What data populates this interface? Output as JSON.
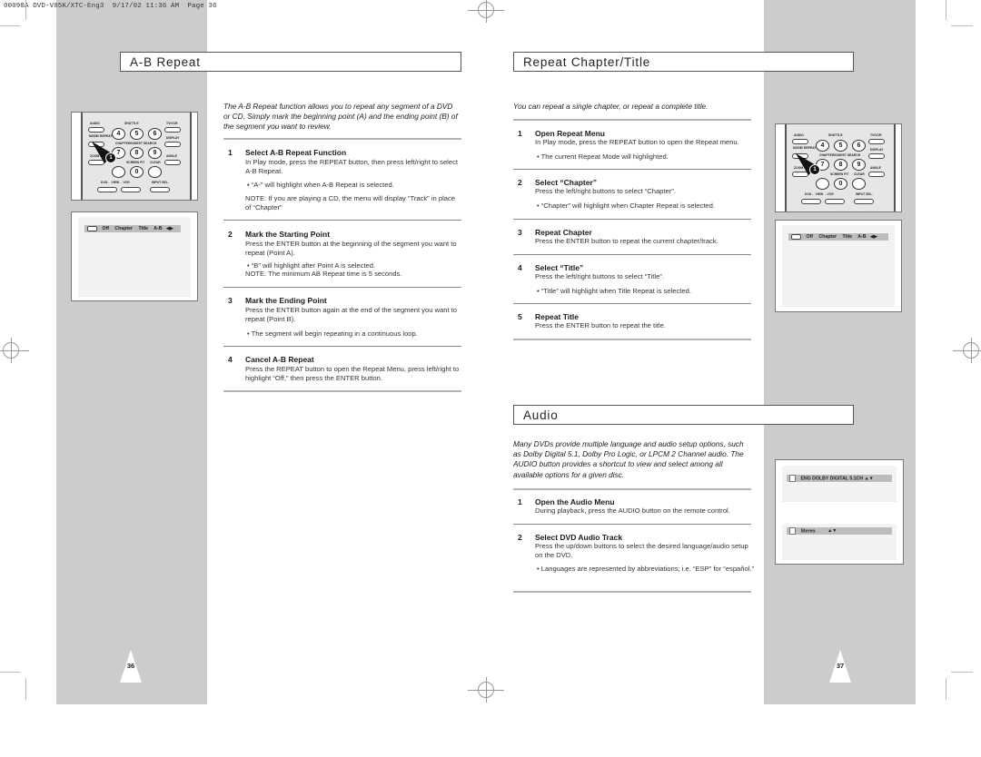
{
  "slug": "00090A DVD-V85K/XTC-Eng3  9/17/02 11:36 AM  Page 36",
  "left_page": {
    "page_number": "36",
    "section_title": "A-B Repeat",
    "intro": "The A-B Repeat function allows you to repeat any segment of a DVD or CD. Simply mark the beginning point (A) and the ending point (B) of the segment you want to review.",
    "steps": [
      {
        "num": "1",
        "title": "Select A-B Repeat Function",
        "text": "In Play mode, press the REPEAT button, then press left/right to select A-B Repeat.",
        "bullet": "“A-” will highlight when A-B Repeat is selected.",
        "note": "NOTE: If you are playing a CD, the menu will display “Track” in place of “Chapter”"
      },
      {
        "num": "2",
        "title": "Mark the Starting Point",
        "text": "Press the ENTER button at the beginning of the segment you want to repeat (Point A).",
        "bullet": "“B” will highlight after Point A is selected.",
        "note": "NOTE: The minimum AB Repeat time is 5 seconds."
      },
      {
        "num": "3",
        "title": "Mark the Ending Point",
        "text": "Press the ENTER button again at the end of the segment you want to repeat (Point B).",
        "bullet": "The segment will begin repeating in a continuous loop."
      },
      {
        "num": "4",
        "title": "Cancel A-B Repeat",
        "text": "Press the REPEAT button to open the Repeat Menu, press left/right to highlight “Off,” then press the ENTER button."
      }
    ],
    "osd_menu": [
      "Off",
      "Chapter",
      "Title",
      "A-B"
    ]
  },
  "right_page": {
    "page_number": "37",
    "section_title": "Repeat Chapter/Title",
    "intro": "You can repeat a single chapter, or repeat a complete title.",
    "steps": [
      {
        "num": "1",
        "title": "Open Repeat Menu",
        "text": "In Play mode, press the REPEAT button to open the Repeat menu.",
        "bullet": "The current Repeat Mode will highlighted."
      },
      {
        "num": "2",
        "title": "Select “Chapter”",
        "text": "Press the left/right buttons to select “Chapter”.",
        "bullet": "“Chapter” will highlight when Chapter Repeat is selected."
      },
      {
        "num": "3",
        "title": "Repeat Chapter",
        "text": "Press the ENTER button to repeat the current chapter/track."
      },
      {
        "num": "4",
        "title": "Select “Title”",
        "text": "Press the left/right buttons to select “Title”.",
        "bullet": "“Title” will highlight when Title Repeat is selected."
      },
      {
        "num": "5",
        "title": "Repeat Title",
        "text": "Press the ENTER button to repeat the title."
      }
    ],
    "osd_menu": [
      "Off",
      "Chapter",
      "Title",
      "A-B"
    ],
    "audio": {
      "section_title": "Audio",
      "intro": "Many DVDs provide multiple language and audio setup options, such as Dolby Digital 5.1, Dolby Pro Logic, or LPCM 2 Channel audio. The AUDIO button provides a shortcut to view and select among all available options for a given disc.",
      "steps": [
        {
          "num": "1",
          "title": "Open the Audio Menu",
          "text": "During playback, press the AUDIO button on the remote control."
        },
        {
          "num": "2",
          "title": "Select DVD Audio Track",
          "text": "Press the up/down buttons to select the desired language/audio setup on the DVD.",
          "bullet": "Languages are represented by abbreviations; i.e. “ESP” for “español.”"
        }
      ],
      "osd_line1": "ENG DOLBY DIGITAL 5.1CH",
      "osd_line2": "Stereo"
    }
  },
  "remote": {
    "labels": {
      "audio": "AUDIO",
      "shuttle": "SHUTTLE",
      "tvvcr": "TV/VCR",
      "mode_repeat": "MODE/ REPEAT",
      "display": "DISPLAY",
      "search": "CHAPTER/DIGEST  SEARCH",
      "zoom": "ZOOM",
      "screen_fit": "SCREEN FIT",
      "clear": "CLEAR",
      "angle": "ANGLE",
      "dvd_view_vcr": "DVD← VIEW →VCR",
      "input_sel": "INPUT SEL."
    },
    "keys": [
      "4",
      "5",
      "6",
      "7",
      "8",
      "9",
      "0"
    ],
    "callout": "1"
  }
}
